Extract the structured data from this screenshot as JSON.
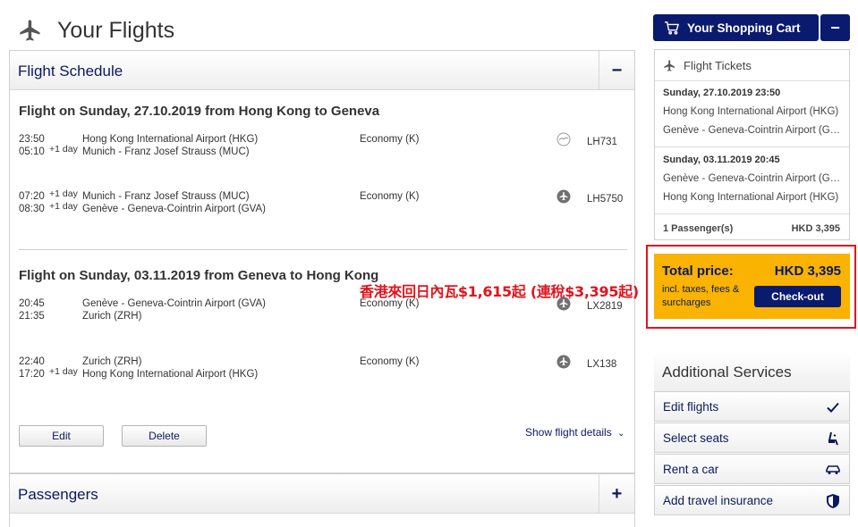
{
  "header": {
    "title": "Your Flights",
    "icon": "plane-icon"
  },
  "schedule": {
    "title": "Flight Schedule",
    "toggle": "−",
    "outbound": {
      "heading": "Flight on Sunday, 27.10.2019 from Hong Kong to Geneva",
      "segments": [
        {
          "dep_time": "23:50",
          "arr_time": "05:10",
          "dep_day": "",
          "arr_day": "+1 day",
          "from": "Hong Kong International Airport (HKG)",
          "to": "Munich - Franz Josef Strauss (MUC)",
          "class": "Economy (K)",
          "flight_no": "LH731",
          "airline_logo": "lufthansa-crane-icon"
        },
        {
          "dep_time": "07:20",
          "arr_time": "08:30",
          "dep_day": "+1 day",
          "arr_day": "+1 day",
          "from": "Munich - Franz Josef Strauss (MUC)",
          "to": "Genève - Geneva-Cointrin Airport (GVA)",
          "class": "Economy (K)",
          "flight_no": "LH5750",
          "airline_logo": "plane-badge-icon"
        }
      ]
    },
    "promo": "香港來回日內瓦$1,615起 (連稅$3,395起)",
    "inbound": {
      "heading": "Flight on Sunday, 03.11.2019 from Geneva to Hong Kong",
      "segments": [
        {
          "dep_time": "20:45",
          "arr_time": "21:35",
          "dep_day": "",
          "arr_day": "",
          "from": "Genève - Geneva-Cointrin Airport (GVA)",
          "to": "Zurich (ZRH)",
          "class": "Economy (K)",
          "flight_no": "LX2819",
          "airline_logo": "plane-badge-icon"
        },
        {
          "dep_time": "22:40",
          "arr_time": "17:20",
          "dep_day": "",
          "arr_day": "+1 day",
          "from": "Zurich (ZRH)",
          "to": "Hong Kong International Airport (HKG)",
          "class": "Economy (K)",
          "flight_no": "LX138",
          "airline_logo": "plane-badge-icon"
        }
      ]
    },
    "edit_label": "Edit",
    "delete_label": "Delete",
    "details_label": "Show flight details"
  },
  "passengers": {
    "title": "Passengers",
    "toggle": "+"
  },
  "cart": {
    "label": "Your Shopping Cart",
    "collapse": "−",
    "tickets_title": "Flight Tickets",
    "out_date": "Sunday, 27.10.2019 23:50",
    "out_from": "Hong Kong International Airport (HKG)",
    "out_to": "Genève - Geneva-Cointrin Airport (GVA)",
    "in_date": "Sunday, 03.11.2019 20:45",
    "in_from": "Genève - Geneva-Cointrin Airport (GVA)",
    "in_to": "Hong Kong International Airport (HKG)",
    "passenger_count": "1 Passenger(s)",
    "passenger_price": "HKD 3,395",
    "total_label": "Total price:",
    "total_value": "HKD 3,395",
    "total_note": "incl. taxes, fees & surcharges",
    "checkout_label": "Check-out"
  },
  "services": {
    "title": "Additional Services",
    "items": [
      {
        "label": "Edit flights",
        "icon": "checkmark-icon"
      },
      {
        "label": "Select seats",
        "icon": "seat-icon"
      },
      {
        "label": "Rent a car",
        "icon": "car-icon"
      },
      {
        "label": "Add travel insurance",
        "icon": "shield-icon"
      }
    ]
  },
  "colors": {
    "brand_navy": "#0a1a6e",
    "accent_yellow": "#f9b300",
    "highlight_red": "#e0141e"
  }
}
